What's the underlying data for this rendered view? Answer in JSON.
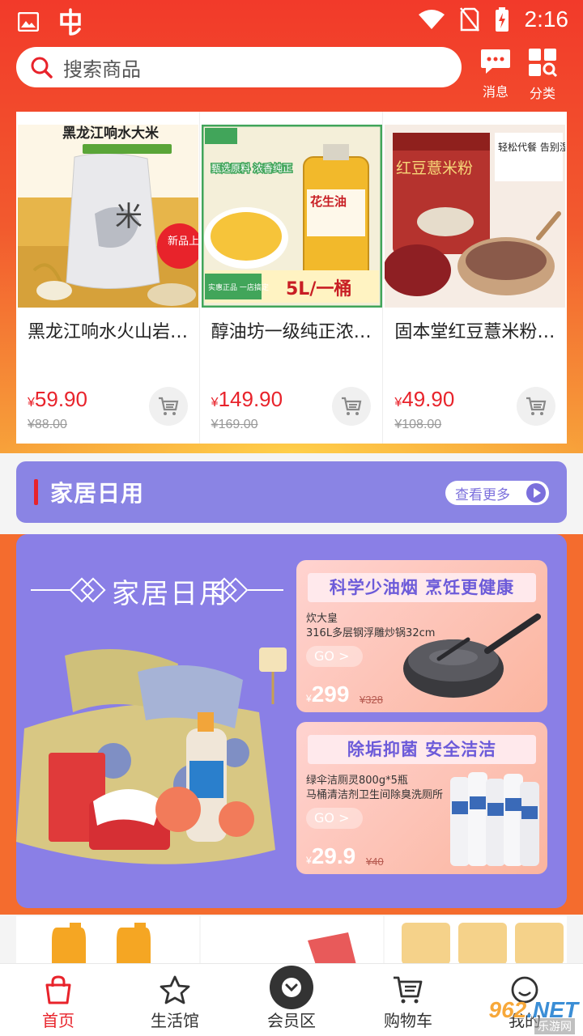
{
  "status_bar": {
    "time": "2:16"
  },
  "search": {
    "placeholder": "搜索商品"
  },
  "header_actions": {
    "message_label": "消息",
    "category_label": "分类"
  },
  "products": [
    {
      "name": "黑龙江响水火山岩…",
      "price": "59.90",
      "old_price": "¥88.00",
      "image_title": "黑龙江响水大米",
      "image_badge": "新品上市"
    },
    {
      "name": "醇油坊一级纯正浓…",
      "price": "149.90",
      "old_price": "¥169.00",
      "image_title": "花生油",
      "image_sub": "甄选原料 浓香纯正",
      "image_banner": "5L/一桶",
      "image_tag": "实惠正品 一店搞定"
    },
    {
      "name": "固本堂红豆薏米粉…",
      "price": "49.90",
      "old_price": "¥108.00",
      "image_title": "红豆薏米粉",
      "image_badge": "轻松代餐 告别湿态"
    }
  ],
  "section": {
    "title": "家居日用",
    "see_more": "查看更多"
  },
  "banner": {
    "title": "家居日用",
    "cards": [
      {
        "slogan": "科学少油烟  烹饪更健康",
        "desc_line1": "炊大皇",
        "desc_line2": "316L多层钢浮雕炒锅32cm",
        "go": "GO >",
        "price": "299",
        "old_price": "¥328"
      },
      {
        "slogan": "除垢抑菌  安全洁洁",
        "desc_line1": "绿伞洁厕灵800g*5瓶",
        "desc_line2": "马桶清洁剂卫生间除臭洗厕所",
        "go": "GO >",
        "price": "29.9",
        "old_price": "¥40"
      }
    ]
  },
  "tabbar": [
    {
      "label": "首页",
      "icon": "bag-icon",
      "active": true
    },
    {
      "label": "生活馆",
      "icon": "star-icon",
      "active": false
    },
    {
      "label": "会员区",
      "icon": "chevron-down-icon",
      "active": false
    },
    {
      "label": "购物车",
      "icon": "cart-icon",
      "active": false
    },
    {
      "label": "我的",
      "icon": "smile-icon",
      "active": false
    }
  ],
  "watermark": {
    "main": "962",
    "suffix": ".NET",
    "sub": "乐游网"
  },
  "colors": {
    "brand_red": "#e8232b",
    "section_purple": "#8a84e4",
    "top_orange": "#f25a2e"
  }
}
